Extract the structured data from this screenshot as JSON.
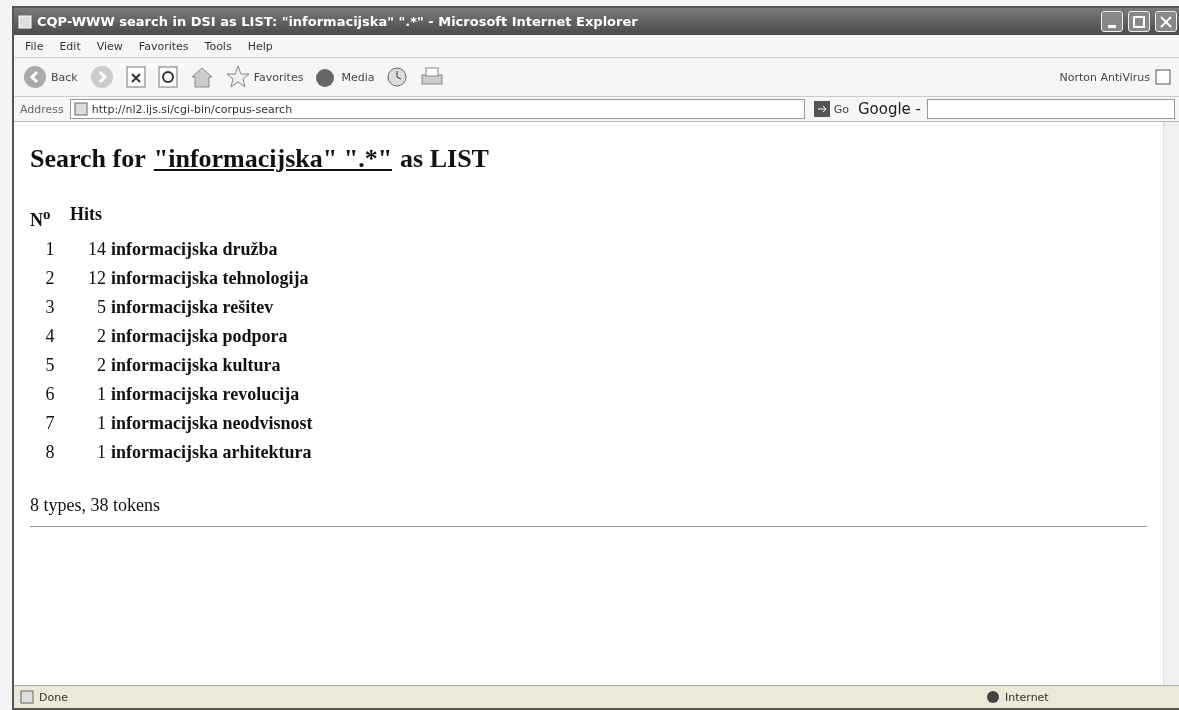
{
  "window": {
    "title": "CQP-WWW search in DSI as LIST: \"informacijska\" \".*\" - Microsoft Internet Explorer"
  },
  "menu": [
    "File",
    "Edit",
    "View",
    "Favorites",
    "Tools",
    "Help"
  ],
  "toolbar": {
    "back": "Back",
    "favorites": "Favorites",
    "media": "Media",
    "norton": "Norton AntiVirus"
  },
  "address_bar": {
    "label": "Address",
    "url": "http://nl2.ijs.si/cgi-bin/corpus-search",
    "go": "Go",
    "google": "Google -"
  },
  "heading": {
    "before": "Search for",
    "query": "\"informacijska\" \".*\"",
    "after": "as LIST"
  },
  "columns": [
    "N$^{o}$",
    "Hits"
  ],
  "rows": [
    {
      "n": "1",
      "hits": "14",
      "term": "informacijska družba"
    },
    {
      "n": "2",
      "hits": "12",
      "term": "informacijska tehnologija"
    },
    {
      "n": "3",
      "hits": "5",
      "term": "informacijska rešitev"
    },
    {
      "n": "4",
      "hits": "2",
      "term": "informacijska podpora"
    },
    {
      "n": "5",
      "hits": "2",
      "term": "informacijska kultura"
    },
    {
      "n": "6",
      "hits": "1",
      "term": "informacijska revolucija"
    },
    {
      "n": "7",
      "hits": "1",
      "term": "informacijska neodvisnost"
    },
    {
      "n": "8",
      "hits": "1",
      "term": "informacijska arhitektura"
    }
  ],
  "summary": "8 types, 38 tokens",
  "status_bar": {
    "text": "Done",
    "zone": "Internet"
  }
}
